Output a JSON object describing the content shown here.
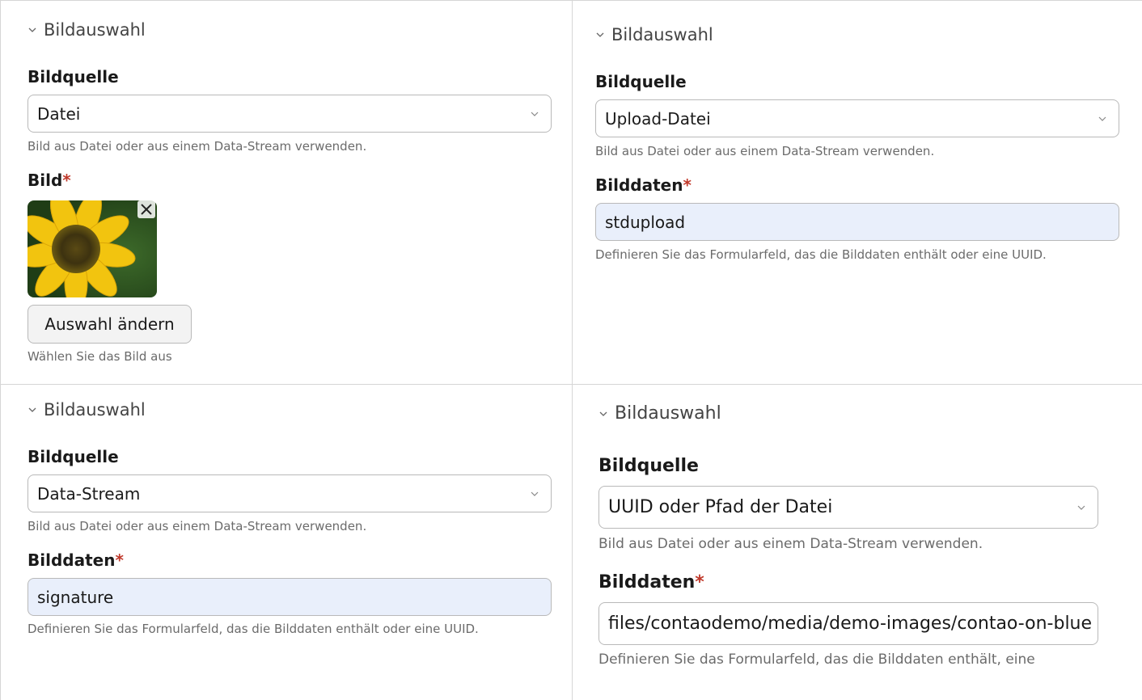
{
  "panels": [
    {
      "legend": "Bildauswahl",
      "source_label": "Bildquelle",
      "source_value": "Datei",
      "source_hint": "Bild aus Datei oder aus einem Data-Stream verwenden.",
      "image_label": "Bild",
      "image_required": "*",
      "change_button": "Auswahl ändern",
      "image_hint": "Wählen Sie das Bild aus"
    },
    {
      "legend": "Bildauswahl",
      "source_label": "Bildquelle",
      "source_value": "Upload-Datei",
      "source_hint": "Bild aus Datei oder aus einem Data-Stream verwenden.",
      "data_label": "Bilddaten",
      "data_required": "*",
      "data_value": "stdupload",
      "data_hint": "Definieren Sie das Formularfeld, das die Bilddaten enthält oder eine UUID."
    },
    {
      "legend": "Bildauswahl",
      "source_label": "Bildquelle",
      "source_value": "Data-Stream",
      "source_hint": "Bild aus Datei oder aus einem Data-Stream verwenden.",
      "data_label": "Bilddaten",
      "data_required": "*",
      "data_value": "signature",
      "data_hint": "Definieren Sie das Formularfeld, das die Bilddaten enthält oder eine UUID."
    },
    {
      "legend": "Bildauswahl",
      "source_label": "Bildquelle",
      "source_value": "UUID oder Pfad der Datei",
      "source_hint": "Bild aus Datei oder aus einem Data-Stream verwenden.",
      "data_label": "Bilddaten",
      "data_required": "*",
      "data_value": "files/contaodemo/media/demo-images/contao-on-blue",
      "data_hint": "Definieren Sie das Formularfeld, das die Bilddaten enthält, eine"
    }
  ],
  "icons": {
    "collapse": "chevron-down-icon",
    "select_arrow": "chevron-down-icon",
    "remove": "close-icon",
    "thumbnail": "sunflower-image"
  },
  "colors": {
    "required": "#c0392b",
    "input_filled_bg": "#e9effb"
  }
}
